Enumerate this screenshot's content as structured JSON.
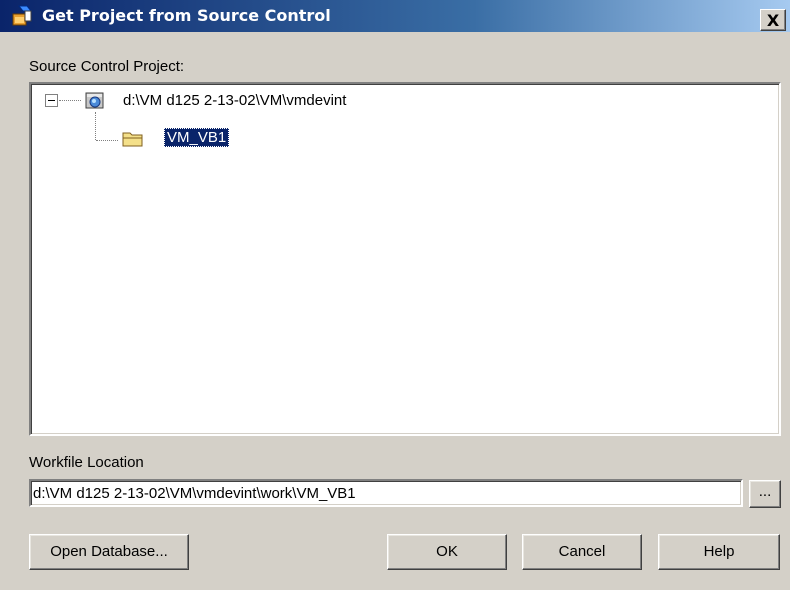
{
  "window": {
    "title": "Get Project from Source Control",
    "close_label": "X"
  },
  "tree": {
    "label": "Source Control Project:",
    "root": {
      "label": "d:\\VM d125 2-13-02\\VM\\vmdevint",
      "icon": "database-icon",
      "expanded": true
    },
    "child": {
      "label": "VM_VB1",
      "icon": "folder-icon",
      "selected": true
    }
  },
  "workfile": {
    "label": "Workfile Location",
    "value": "d:\\VM d125 2-13-02\\VM\\vmdevint\\work\\VM_VB1",
    "browse_label": "..."
  },
  "buttons": {
    "open_database": "Open Database...",
    "ok": "OK",
    "cancel": "Cancel",
    "help": "Help"
  },
  "colors": {
    "dialog_bg": "#d4d0c8",
    "title_active": "#0a246a",
    "selection": "#0a246a"
  }
}
